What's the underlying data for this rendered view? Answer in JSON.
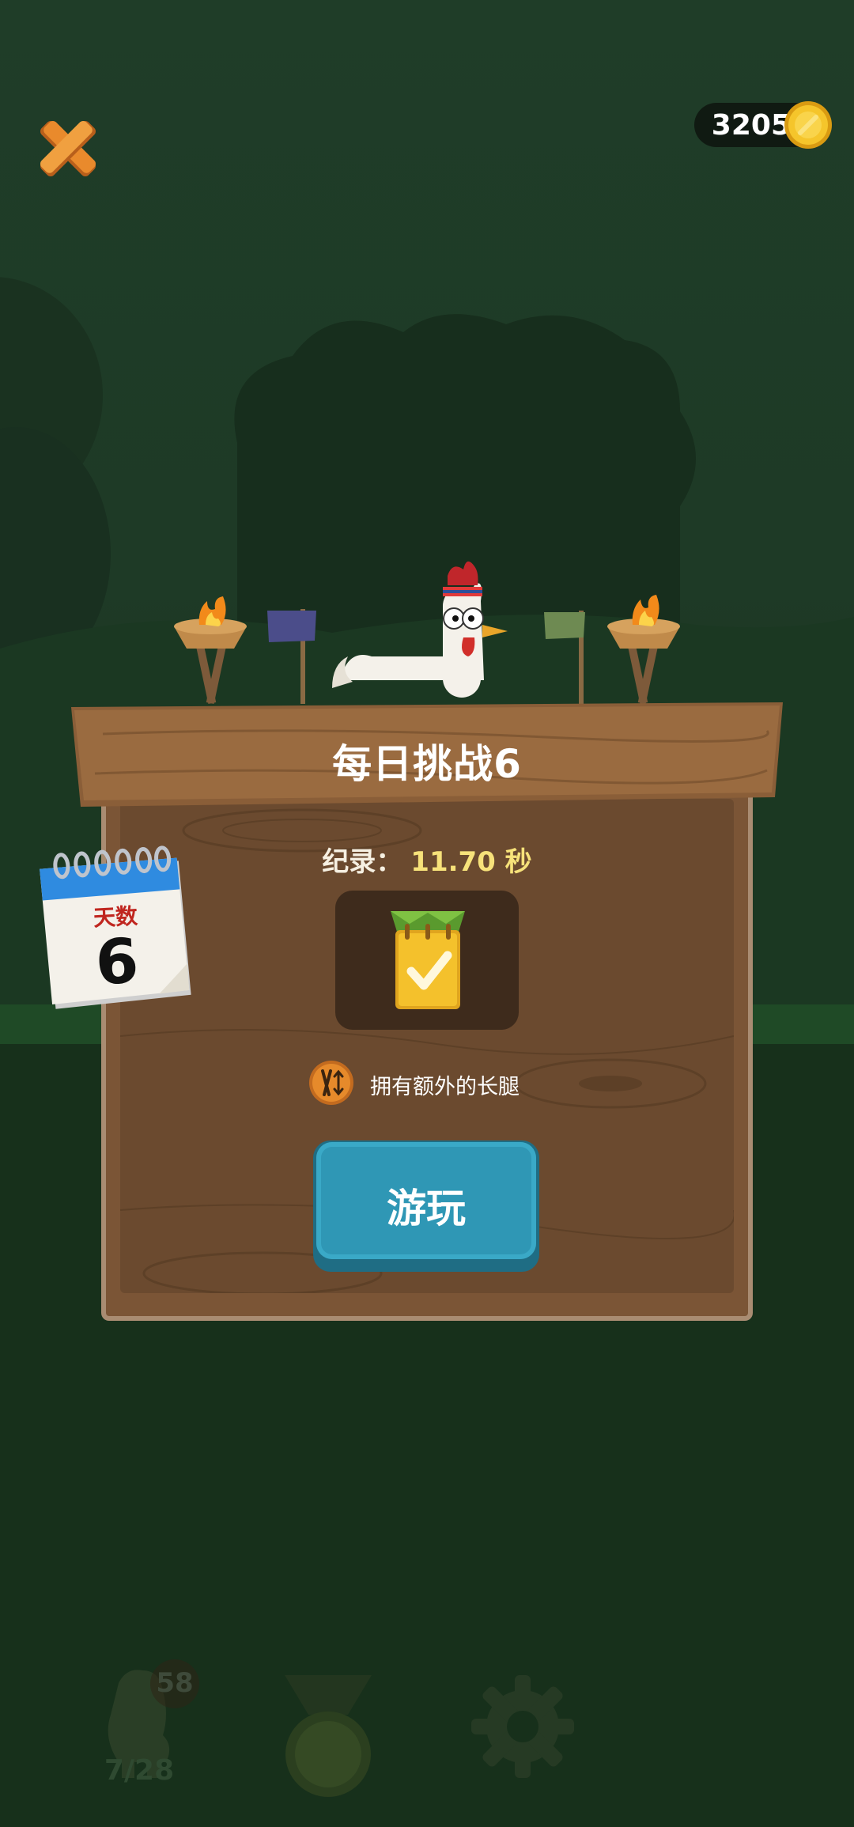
{
  "game": {
    "coins": "3205",
    "title": "每日挑战6",
    "record_label": "纪录：",
    "record_value": "11.70 秒",
    "perk_text": "拥有额外的长腿",
    "play_label": "游玩",
    "calendar": {
      "label": "天数",
      "day": "6"
    },
    "nav": {
      "badge": "58",
      "progress": "7/28"
    }
  },
  "icons": {
    "close": "close-x-icon",
    "coin": "gold-coin-icon",
    "reward": "calendar-check-icon",
    "perk": "long-legs-icon",
    "medal": "medal-icon",
    "settings": "gear-icon"
  },
  "colors": {
    "background": "#1e3a24",
    "board": "#6b4a2f",
    "play_button": "#2f97b5",
    "record_value": "#f7e27a",
    "close_icon": "#e98a2c"
  }
}
